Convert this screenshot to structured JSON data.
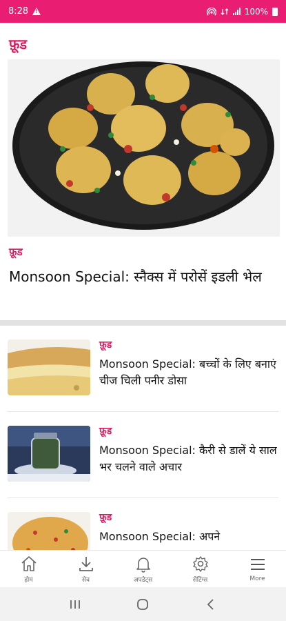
{
  "status_bar": {
    "time": "8:28",
    "battery": "100%",
    "icons": [
      "warning-icon",
      "hotspot-icon",
      "data-icon",
      "signal-icon",
      "battery-icon"
    ]
  },
  "colors": {
    "accent": "#e91e73",
    "category": "#d81b60"
  },
  "section": {
    "title": "फ़ूड"
  },
  "hero": {
    "category": "फ़ूड",
    "title": "Monsoon Special: स्नैक्स में परोसें इडली भेल",
    "image": "idli-bhel-plate"
  },
  "articles": [
    {
      "category": "फ़ूड",
      "title": "Monsoon Special: बच्चों के लिए बनाएं चीज चिली पनीर डोसा",
      "image": "cheese-dosa"
    },
    {
      "category": "फ़ूड",
      "title": "Monsoon Special: कैरी से डालें ये साल भर चलने वाले अचार",
      "image": "pickle-jar"
    },
    {
      "category": "फ़ूड",
      "title": "Monsoon Special: अपने",
      "image": "veg-noodles"
    }
  ],
  "bottom_nav": [
    {
      "label": "होम",
      "icon": "home-icon"
    },
    {
      "label": "सेव",
      "icon": "download-icon"
    },
    {
      "label": "अपडेट्स",
      "icon": "bell-icon"
    },
    {
      "label": "सेटिंग्स",
      "icon": "gear-icon"
    },
    {
      "label": "More",
      "icon": "menu-icon"
    }
  ],
  "system_nav": [
    "recents-icon",
    "home-circle-icon",
    "back-icon"
  ]
}
